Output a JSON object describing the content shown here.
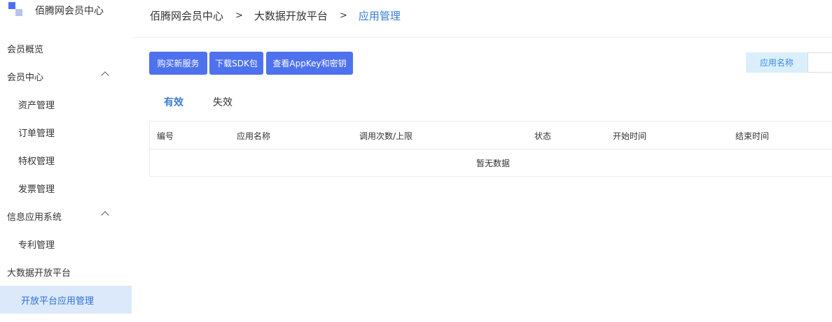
{
  "sidebar": {
    "logo_text": "佰腾网会员中心",
    "items": [
      {
        "label": "会员概览"
      },
      {
        "label": "会员中心"
      },
      {
        "label": "资产管理"
      },
      {
        "label": "订单管理"
      },
      {
        "label": "特权管理"
      },
      {
        "label": "发票管理"
      },
      {
        "label": "信息应用系统"
      },
      {
        "label": "专利管理"
      },
      {
        "label": "大数据开放平台"
      },
      {
        "label": "开放平台应用管理"
      }
    ]
  },
  "breadcrumb": {
    "items": [
      "佰腾网会员中心",
      "大数据开放平台",
      "应用管理"
    ],
    "separator": ">"
  },
  "toolbar": {
    "buy_label": "购买新服务",
    "sdk_label": "下载SDK包",
    "key_label": "查看AppKey和密钥"
  },
  "filter": {
    "label": "应用名称",
    "value": ""
  },
  "tabs": [
    {
      "label": "有效",
      "active": true
    },
    {
      "label": "失效",
      "active": false
    }
  ],
  "table": {
    "columns": [
      "编号",
      "应用名称",
      "调用次数/上限",
      "状态",
      "开始时间",
      "结束时间"
    ],
    "empty_text": "暂无数据"
  },
  "colors": {
    "accent": "#4e72ee",
    "active_link": "#3a7bd5",
    "active_nav_bg": "#dbe9fb",
    "filter_label_bg": "#dbeefb"
  }
}
